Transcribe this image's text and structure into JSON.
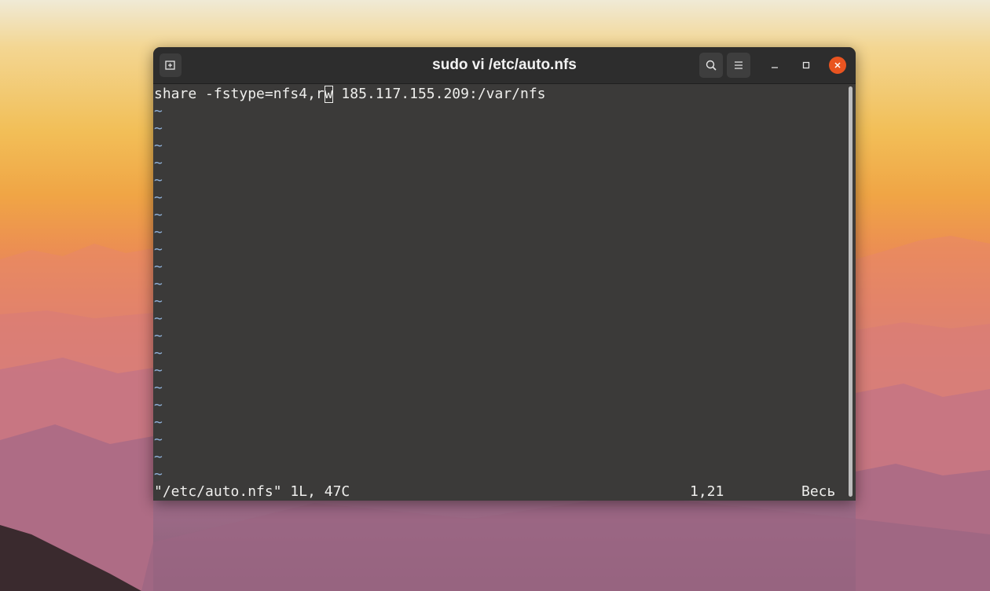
{
  "window": {
    "title": "sudo vi /etc/auto.nfs"
  },
  "icons": {
    "new_tab": "new-tab-icon",
    "search": "search-icon",
    "menu": "hamburger-menu-icon",
    "minimize": "minimize-icon",
    "maximize": "maximize-icon",
    "close": "close-icon"
  },
  "colors": {
    "terminal_bg": "#3b3a39",
    "titlebar_bg": "#2d2d2d",
    "close_button": "#e95420",
    "tilde": "#8fb0d8",
    "text": "#eeeeec"
  },
  "editor": {
    "line1_before_cursor": "share -fstype=nfs4,r",
    "cursor_char": "w",
    "line1_after_cursor": " 185.117.155.209:/var/nfs",
    "empty_line_marker": "~",
    "empty_lines": 22
  },
  "status": {
    "file_info": "\"/etc/auto.nfs\" 1L, 47C",
    "position": "1,21",
    "scroll": "Весь"
  }
}
